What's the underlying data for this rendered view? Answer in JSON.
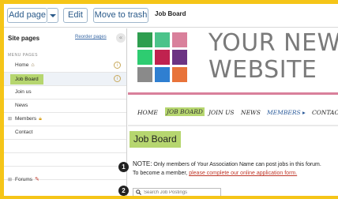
{
  "toolbar": {
    "add_page_label": "Add page",
    "edit_label": "Edit",
    "trash_label": "Move to trash",
    "breadcrumb": "Job Board"
  },
  "sidebar": {
    "title": "Site pages",
    "reorder_label": "Reorder pages",
    "collapse_glyph": "«",
    "section_label": "MENU PAGES",
    "items": [
      {
        "label": "Home",
        "icon": "home-icon"
      },
      {
        "label": "Job Board",
        "selected": true
      },
      {
        "label": "Join us"
      },
      {
        "label": "News"
      },
      {
        "label": "Members",
        "icon": "lock-icon",
        "expandable": true
      },
      {
        "label": "Contact"
      },
      {
        "label": "Forums",
        "icon": "quill-icon",
        "expandable": true
      }
    ],
    "info_glyph": "i",
    "expand_glyph": "⊞"
  },
  "site": {
    "name_line1": "YOUR NEW",
    "name_line2": "WEBSITE",
    "logo_colors": [
      "#2e9e4f",
      "#4cc38a",
      "#d9809b",
      "#2ecc71",
      "#c0224f",
      "#6c3483",
      "#8a8a8a",
      "#2f7fd1",
      "#e8733a"
    ],
    "accent": "#b6d66f"
  },
  "nav": {
    "items": [
      "HOME",
      "JOB BOARD",
      "JOIN US",
      "NEWS",
      "MEMBERS ▸",
      "CONTACT"
    ]
  },
  "content": {
    "heading": "Job Board",
    "note_prefix": "NOTE:",
    "note_text": " Only members of Your Association Name can post jobs in this forum.",
    "become_text": "To become a member, ",
    "become_link": "please complete our online application form.",
    "search_placeholder": "Search Job Postings"
  },
  "steps": [
    "1",
    "2"
  ]
}
